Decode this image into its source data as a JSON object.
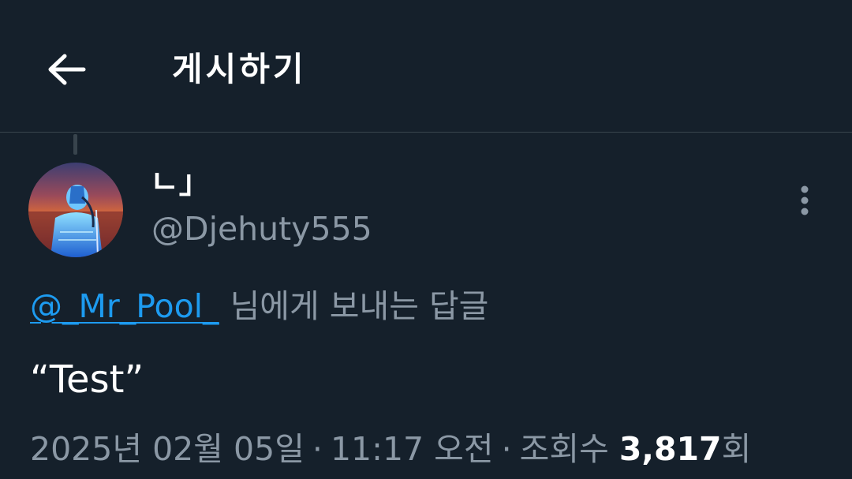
{
  "header": {
    "title": "게시하기",
    "back_icon": "arrow-left-icon"
  },
  "post": {
    "display_name": "ㄴ」",
    "handle": "@Djehuty555",
    "avatar_icon": "avatar-image",
    "more_icon": "more-vertical-icon",
    "reply_to_mention": "@_Mr_Pool_",
    "reply_to_suffix": "님에게 보내는 답글",
    "text": "“Test”",
    "date": "2025년 02월 05일",
    "separator": "·",
    "time": "11:17 오전",
    "views_label": "조회수",
    "views_count": "3,817",
    "views_unit": "회"
  },
  "colors": {
    "background": "#15202b",
    "divider": "#38444d",
    "secondary_text": "#8b98a5",
    "link": "#1d9bf0",
    "primary_text": "#ffffff"
  }
}
